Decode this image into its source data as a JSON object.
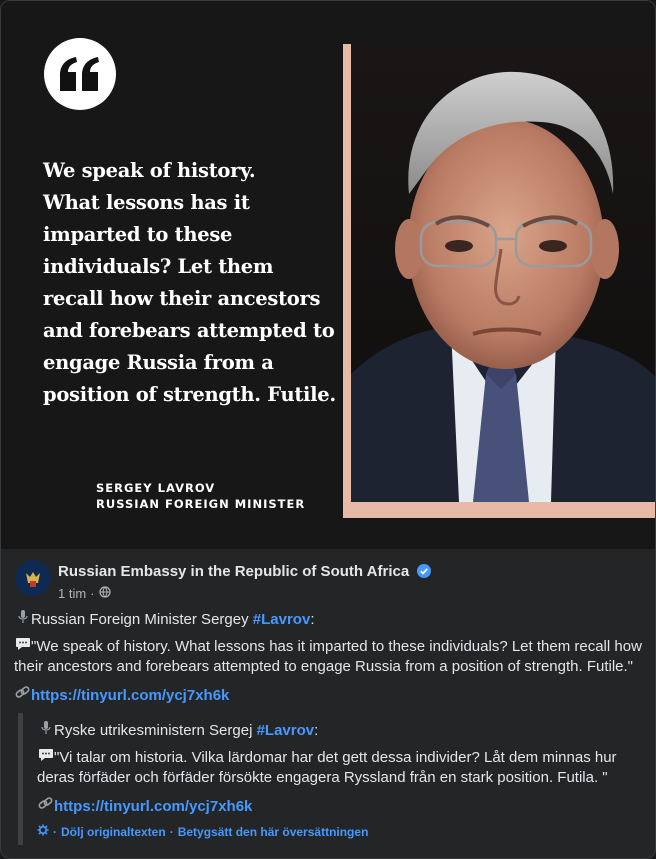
{
  "hero": {
    "quote_lines": [
      "We speak of history.",
      "What lessons has it",
      "imparted to these",
      "individuals? Let them",
      "recall how their ancestors",
      "and forebears attempted to",
      "engage Russia from a",
      "position of strength. Futile."
    ],
    "signature_name": "SERGEY LAVROV",
    "signature_title": "RUSSIAN FOREIGN MINISTER"
  },
  "post": {
    "page_name": "Russian Embassy in the Republic of South Africa",
    "time": "1 tim",
    "separator": "·",
    "line1_prefix": "Russian Foreign Minister Sergey ",
    "line1_tag": "#Lavrov",
    "line1_suffix": ":",
    "quote": "\"We speak of history. What lessons has it imparted to these individuals? Let them recall how their ancestors and forebears attempted to engage Russia from a position of strength. Futile.\"",
    "link": "https://tinyurl.com/ycj7xh6k"
  },
  "translation": {
    "line1_prefix": "Ryske utrikesministern Sergej ",
    "line1_tag": "#Lavrov",
    "line1_suffix": ":",
    "quote": "\"Vi talar om historia. Vilka lärdomar har det gett dessa individer? Låt dem minnas hur deras förfäder och förfäder försökte engagera Ryssland från en stark position. Futila. \"",
    "link": "https://tinyurl.com/ycj7xh6k",
    "hide_original": "Dölj originaltexten",
    "rate": "Betygsätt den här översättningen",
    "dot": "·"
  },
  "colors": {
    "link": "#4599ff",
    "background": "#242526",
    "frame": "#e8b9a6"
  },
  "icons": [
    "quote-icon",
    "globe-icon",
    "verified-icon",
    "microphone-icon",
    "speech-bubble-icon",
    "link-icon",
    "translate-gear-icon"
  ]
}
